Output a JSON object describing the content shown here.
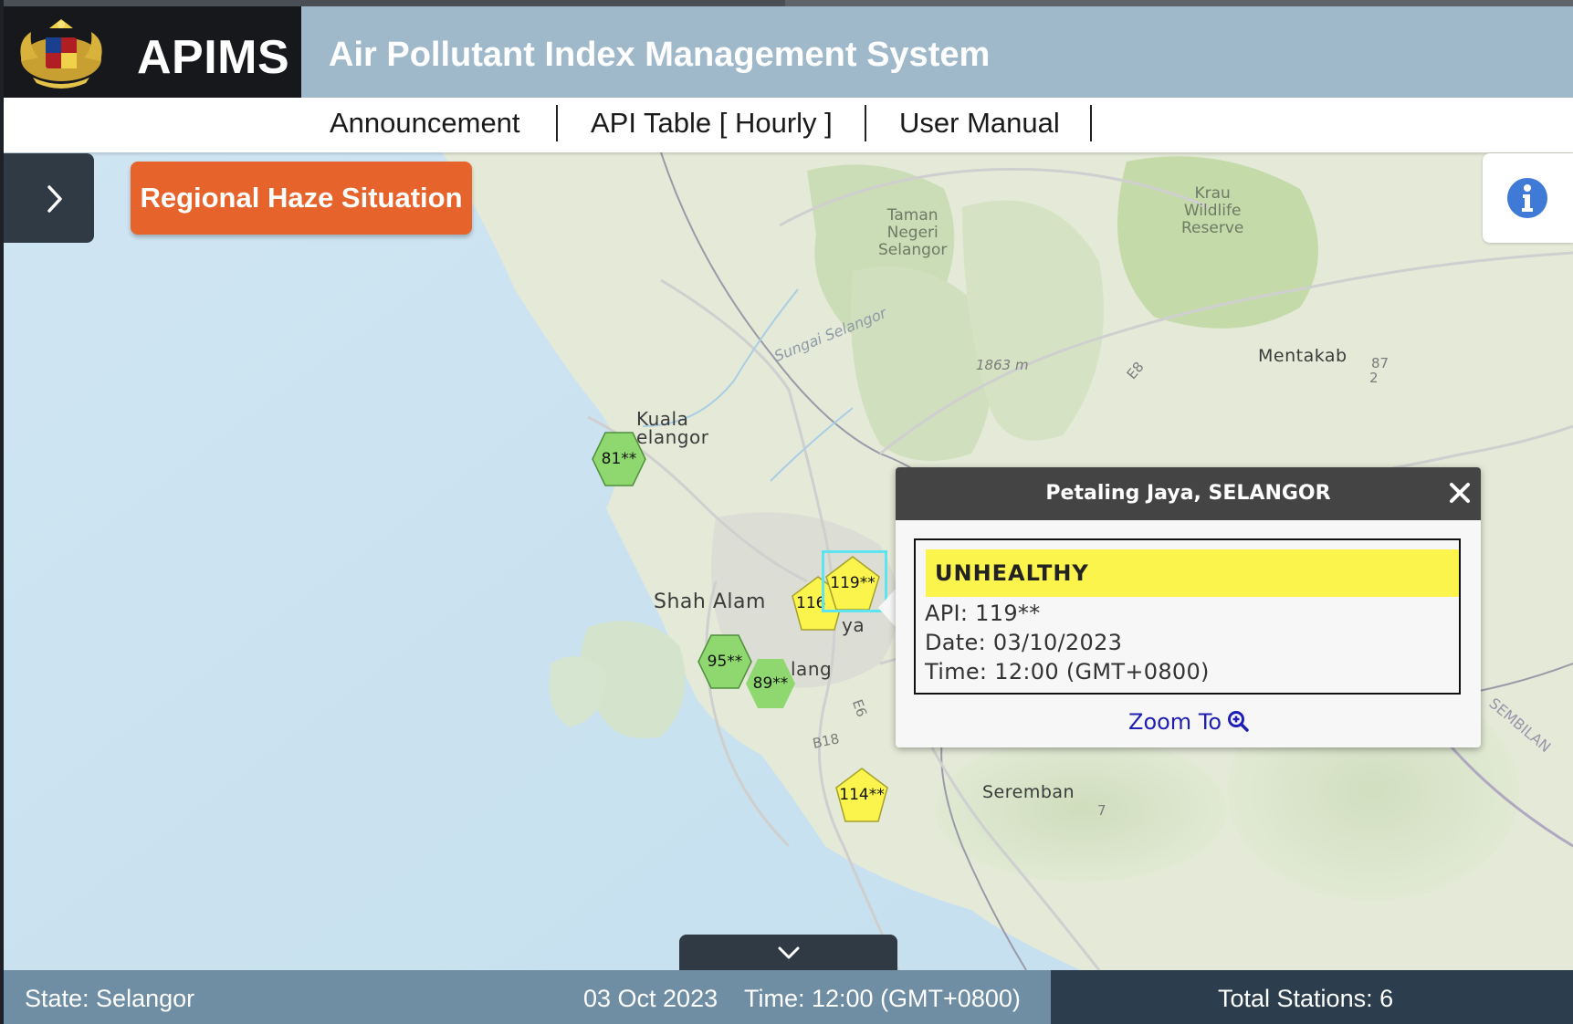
{
  "header": {
    "brand": "APIMS",
    "title": "Air Pollutant Index Management System"
  },
  "nav": {
    "items": [
      {
        "label": "Announcement"
      },
      {
        "label": "API Table [ Hourly ]"
      },
      {
        "label": "User Manual"
      }
    ]
  },
  "haze_button": "Regional Haze Situation",
  "map_labels": {
    "kuala_selangor": "Kuala\nelangor",
    "kuala_1": "Kuala",
    "kuala_2": "elangor",
    "shah_alam": "Shah Alam",
    "ya": "ya",
    "lang": "lang",
    "seremban": "Seremban",
    "mentakab": "Mentakab",
    "park_1": "Taman",
    "park_2": "Negeri",
    "park_3": "Selangor",
    "reserve_1": "Krau",
    "reserve_2": "Wildlife",
    "reserve_3": "Reserve",
    "elevation": "1863 m",
    "river": "Sungai Selangor",
    "road_e8": "E8",
    "road_e6": "E6",
    "road_b18": "B18",
    "road_87": "87",
    "road_2": "2",
    "road_7": "7",
    "sembilan": "SEMBILAN"
  },
  "stations": [
    {
      "label": "81**",
      "api": 81,
      "status": "Good",
      "color": "#8fd86f",
      "shape": "hexagon"
    },
    {
      "label": "119**",
      "api": 119,
      "status": "Unhealthy",
      "color": "#fbf44c",
      "shape": "pentagon"
    },
    {
      "label": "116**",
      "api": 116,
      "status": "Unhealthy",
      "color": "#fbf44c",
      "shape": "pentagon"
    },
    {
      "label": "95**",
      "api": 95,
      "status": "Good",
      "color": "#8fd86f",
      "shape": "hexagon"
    },
    {
      "label": "89**",
      "api": 89,
      "status": "Good",
      "color": "#8fd86f",
      "shape": "hexagon"
    },
    {
      "label": "114**",
      "api": 114,
      "status": "Unhealthy",
      "color": "#fbf44c",
      "shape": "pentagon"
    }
  ],
  "marker_116_visible": "116",
  "popup": {
    "title": "Petaling Jaya, SELANGOR",
    "status": "UNHEALTHY",
    "api": "API: 119**",
    "date": "Date: 03/10/2023",
    "time": "Time: 12:00 (GMT+0800)",
    "zoom": "Zoom To",
    "status_color": "#fbf44c"
  },
  "statusbar": {
    "state": "State: Selangor",
    "date": "03 Oct 2023",
    "time": "Time: 12:00 (GMT+0800)",
    "total": "Total Stations: 6"
  },
  "icons": {
    "sidebar_toggle": "chevron-right-icon",
    "info": "info-icon",
    "close": "close-icon",
    "zoom": "zoom-in-icon",
    "bottom_toggle": "chevron-down-icon",
    "crest": "coat-of-arms-logo"
  }
}
